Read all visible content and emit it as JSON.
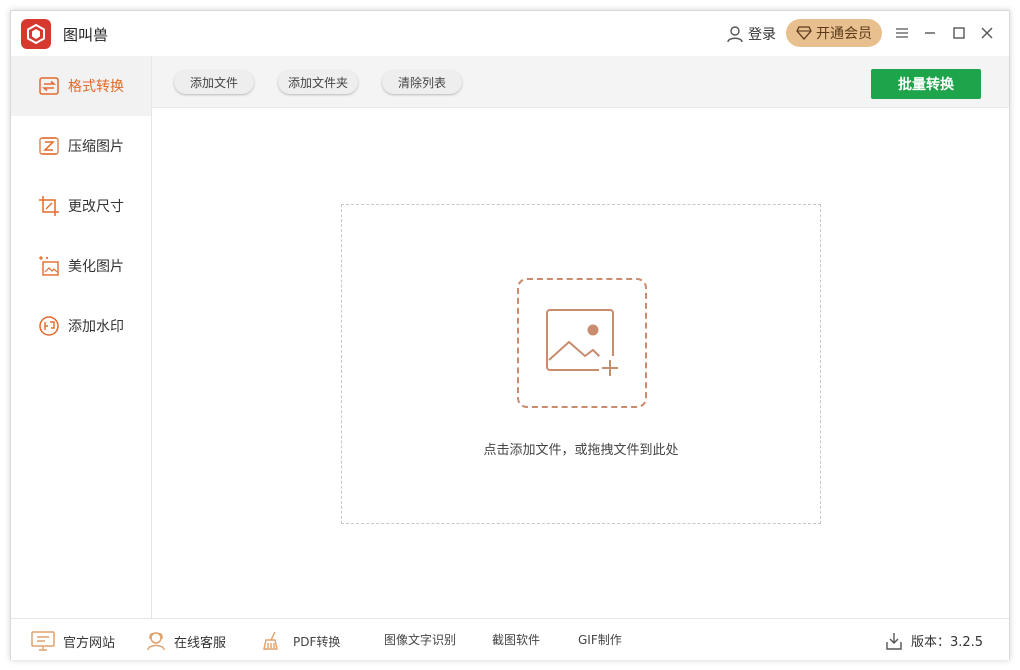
{
  "app": {
    "title": "图叫兽"
  },
  "titlebar": {
    "login": "登录",
    "vip": "开通会员"
  },
  "sidebar": {
    "items": [
      {
        "label": "格式转换",
        "active": true
      },
      {
        "label": "压缩图片"
      },
      {
        "label": "更改尺寸"
      },
      {
        "label": "美化图片"
      },
      {
        "label": "添加水印"
      }
    ]
  },
  "toolbar": {
    "add_file": "添加文件",
    "add_folder": "添加文件夹",
    "clear_list": "清除列表",
    "batch_convert": "批量转换"
  },
  "dropzone": {
    "hint": "点击添加文件，或拖拽文件到此处"
  },
  "footer": {
    "website": "官方网站",
    "service": "在线客服",
    "pdf": "PDF转换",
    "ocr": "图像文字识别",
    "screenshot": "截图软件",
    "gif": "GIF制作",
    "version": "版本：3.2.5"
  },
  "colors": {
    "accent": "#e36a2a",
    "primary": "#1ea44b",
    "vip": "#e8c08f",
    "logo": "#d63a2f"
  }
}
